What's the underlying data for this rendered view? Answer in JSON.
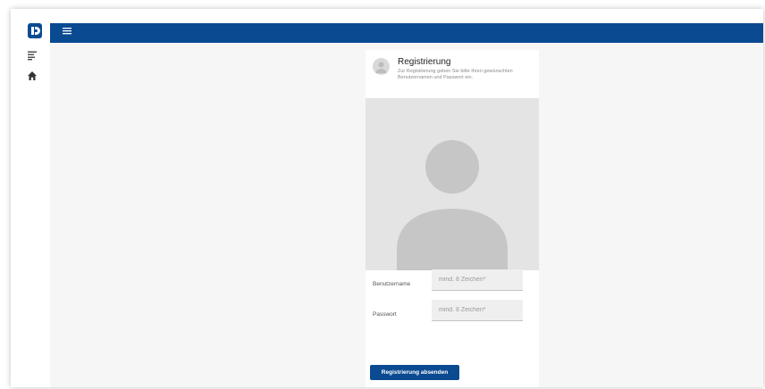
{
  "app": {
    "logo_icon": "logo-d-icon",
    "colors": {
      "primary": "#0a4a91",
      "background": "#f6f6f6",
      "placeholder_image": "#e4e4e4"
    }
  },
  "sidebar": {
    "items": [
      {
        "icon": "filter-list-icon"
      },
      {
        "icon": "home-icon"
      }
    ]
  },
  "topbar": {
    "menu_icon": "hamburger-menu-icon"
  },
  "card": {
    "title": "Registrierung",
    "subtitle": "Zur Registrierung geben Sie bitte Ihren gewünschten Benutzernamen und Passwort ein.",
    "media_icon": "user-silhouette-icon",
    "fields": {
      "username": {
        "label": "Benutzername",
        "placeholder": "mind. 8 Zeichen*",
        "value": ""
      },
      "password": {
        "label": "Passwort",
        "placeholder": "mind. 8 Zeichen*",
        "value": ""
      }
    },
    "submit_label": "Registrierung absenden"
  }
}
